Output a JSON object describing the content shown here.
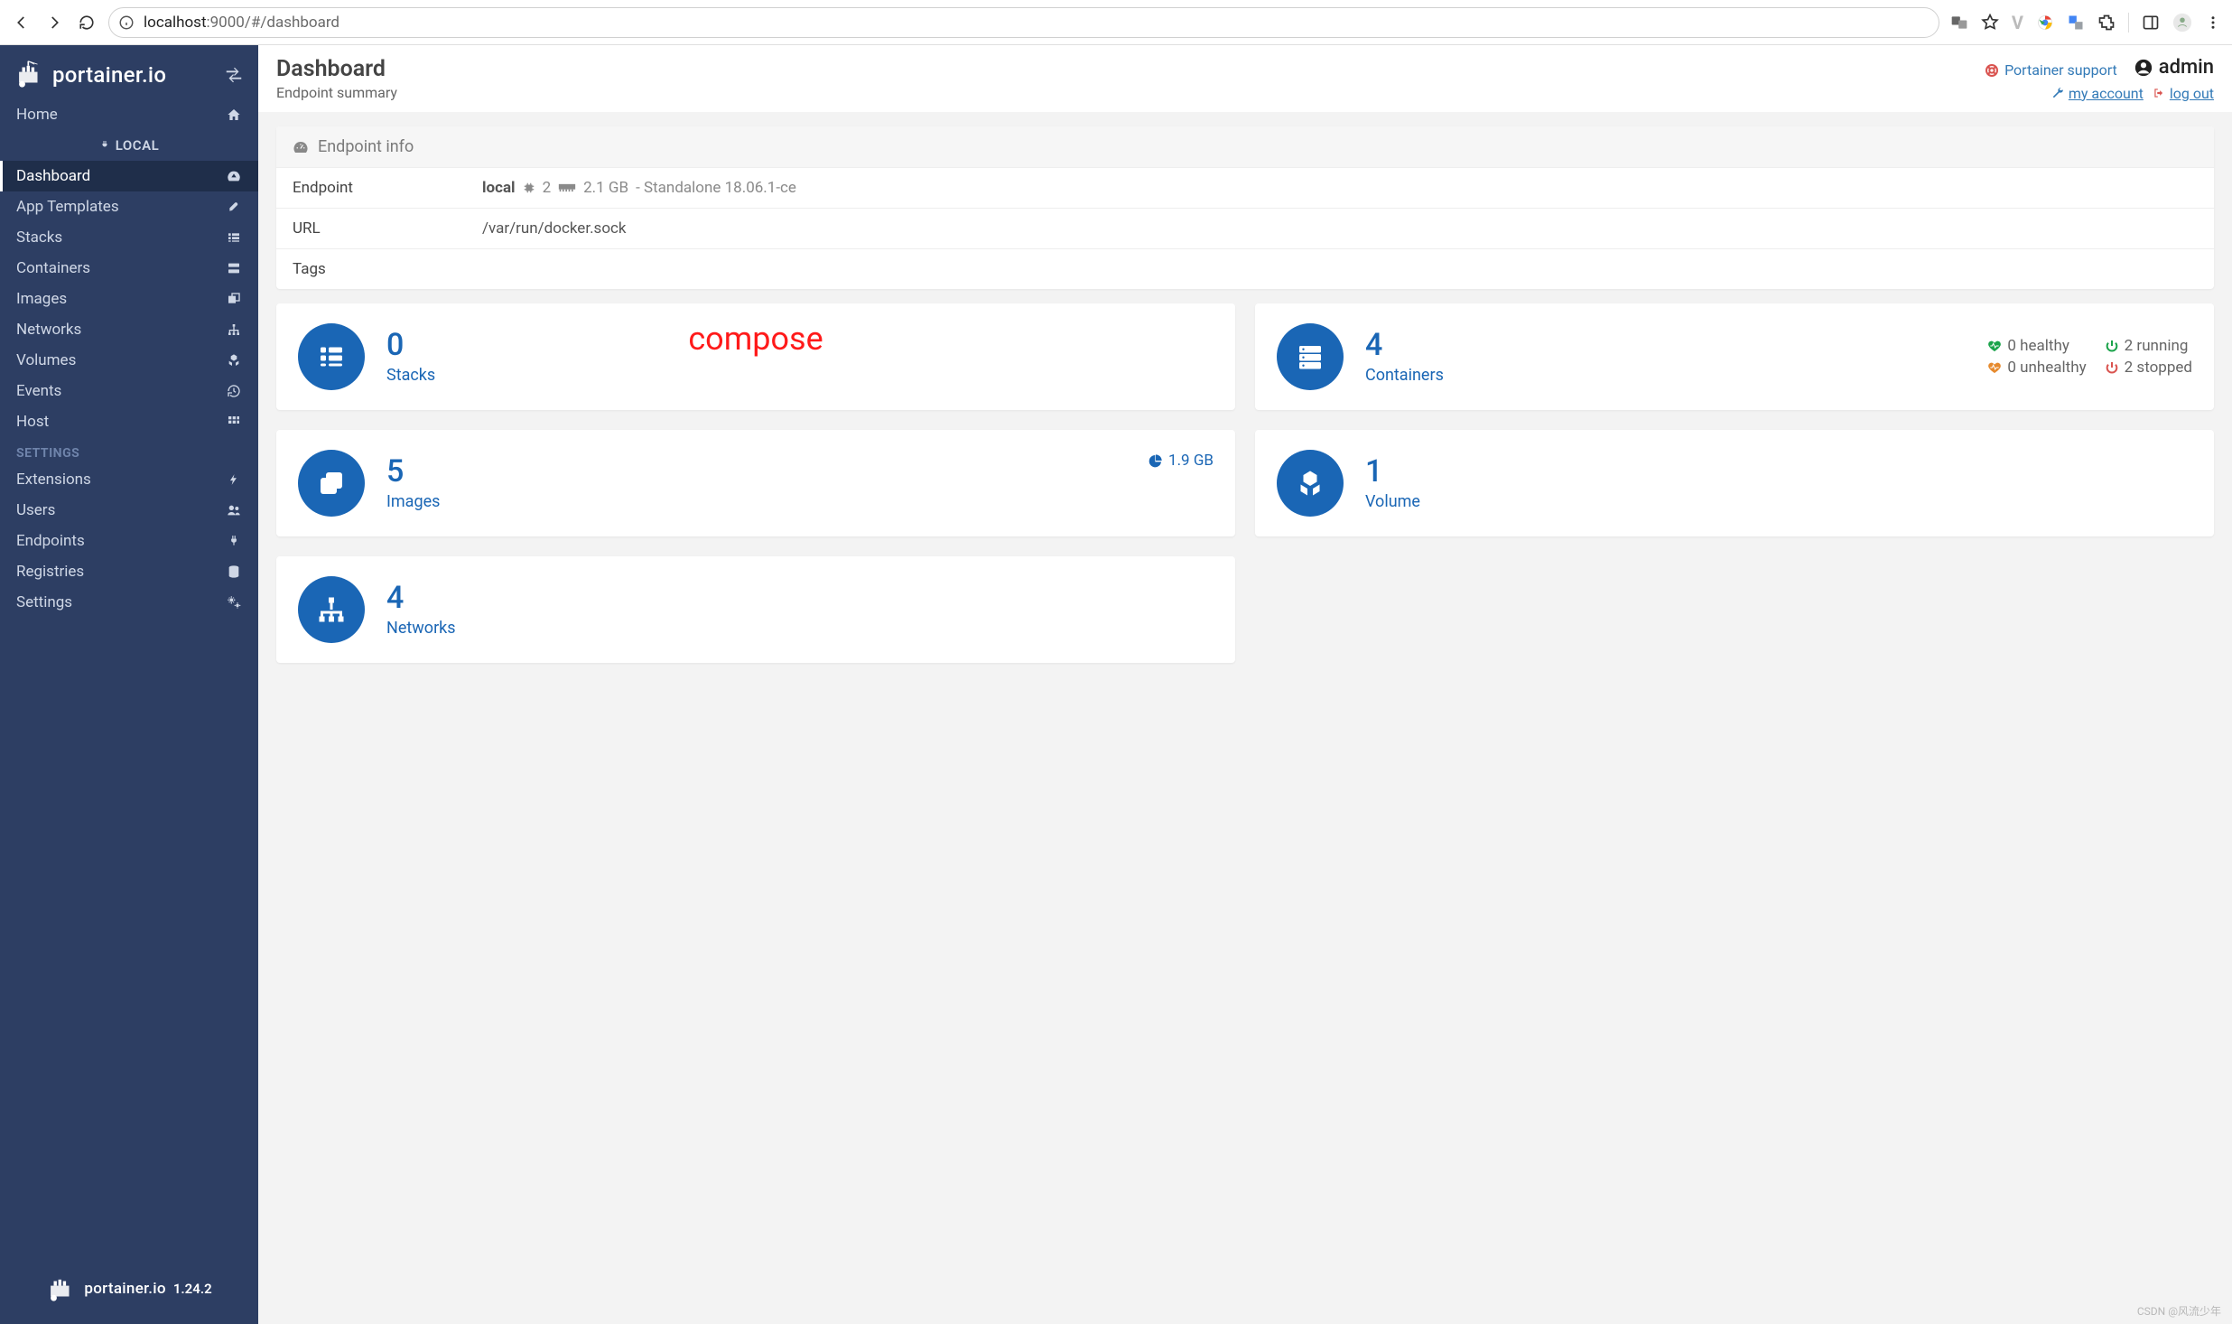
{
  "browser": {
    "url_host": "localhost",
    "url_port": ":9000",
    "url_path": "/#/dashboard"
  },
  "brand": {
    "name": "portainer.io",
    "version": "1.24.2"
  },
  "header": {
    "title": "Dashboard",
    "subtitle": "Endpoint summary",
    "support": "Portainer support",
    "user": "admin",
    "my_account": "my account",
    "logout": "log out",
    "user_icon_glyph": "account_circle"
  },
  "sidebar": {
    "local_label": "LOCAL",
    "settings_heading": "SETTINGS",
    "items_top": [
      {
        "label": "Home",
        "icon": "home"
      }
    ],
    "items_local": [
      {
        "label": "Dashboard",
        "icon": "dashboard",
        "active": true
      },
      {
        "label": "App Templates",
        "icon": "rocket"
      },
      {
        "label": "Stacks",
        "icon": "list"
      },
      {
        "label": "Containers",
        "icon": "server"
      },
      {
        "label": "Images",
        "icon": "clone"
      },
      {
        "label": "Networks",
        "icon": "sitemap"
      },
      {
        "label": "Volumes",
        "icon": "hdd"
      },
      {
        "label": "Events",
        "icon": "history"
      },
      {
        "label": "Host",
        "icon": "th"
      }
    ],
    "items_settings": [
      {
        "label": "Extensions",
        "icon": "bolt"
      },
      {
        "label": "Users",
        "icon": "users"
      },
      {
        "label": "Endpoints",
        "icon": "plug"
      },
      {
        "label": "Registries",
        "icon": "database"
      },
      {
        "label": "Settings",
        "icon": "cogs"
      }
    ]
  },
  "endpoint_info": {
    "panel_title": "Endpoint info",
    "rows": {
      "endpoint_label": "Endpoint",
      "endpoint_name": "local",
      "cpu": "2",
      "mem": "2.1 GB",
      "mode": "- Standalone 18.06.1-ce",
      "url_label": "URL",
      "url_value": "/var/run/docker.sock",
      "tags_label": "Tags",
      "tags_value": ""
    }
  },
  "tiles": {
    "stacks": {
      "count": "0",
      "label": "Stacks",
      "annotation": "compose"
    },
    "containers": {
      "count": "4",
      "label": "Containers",
      "healthy": "0 healthy",
      "unhealthy": "0 unhealthy",
      "running": "2 running",
      "stopped": "2 stopped"
    },
    "images": {
      "count": "5",
      "label": "Images",
      "size": "1.9 GB"
    },
    "volumes": {
      "count": "1",
      "label": "Volume"
    },
    "networks": {
      "count": "4",
      "label": "Networks"
    }
  },
  "watermark": "CSDN @风流少年"
}
